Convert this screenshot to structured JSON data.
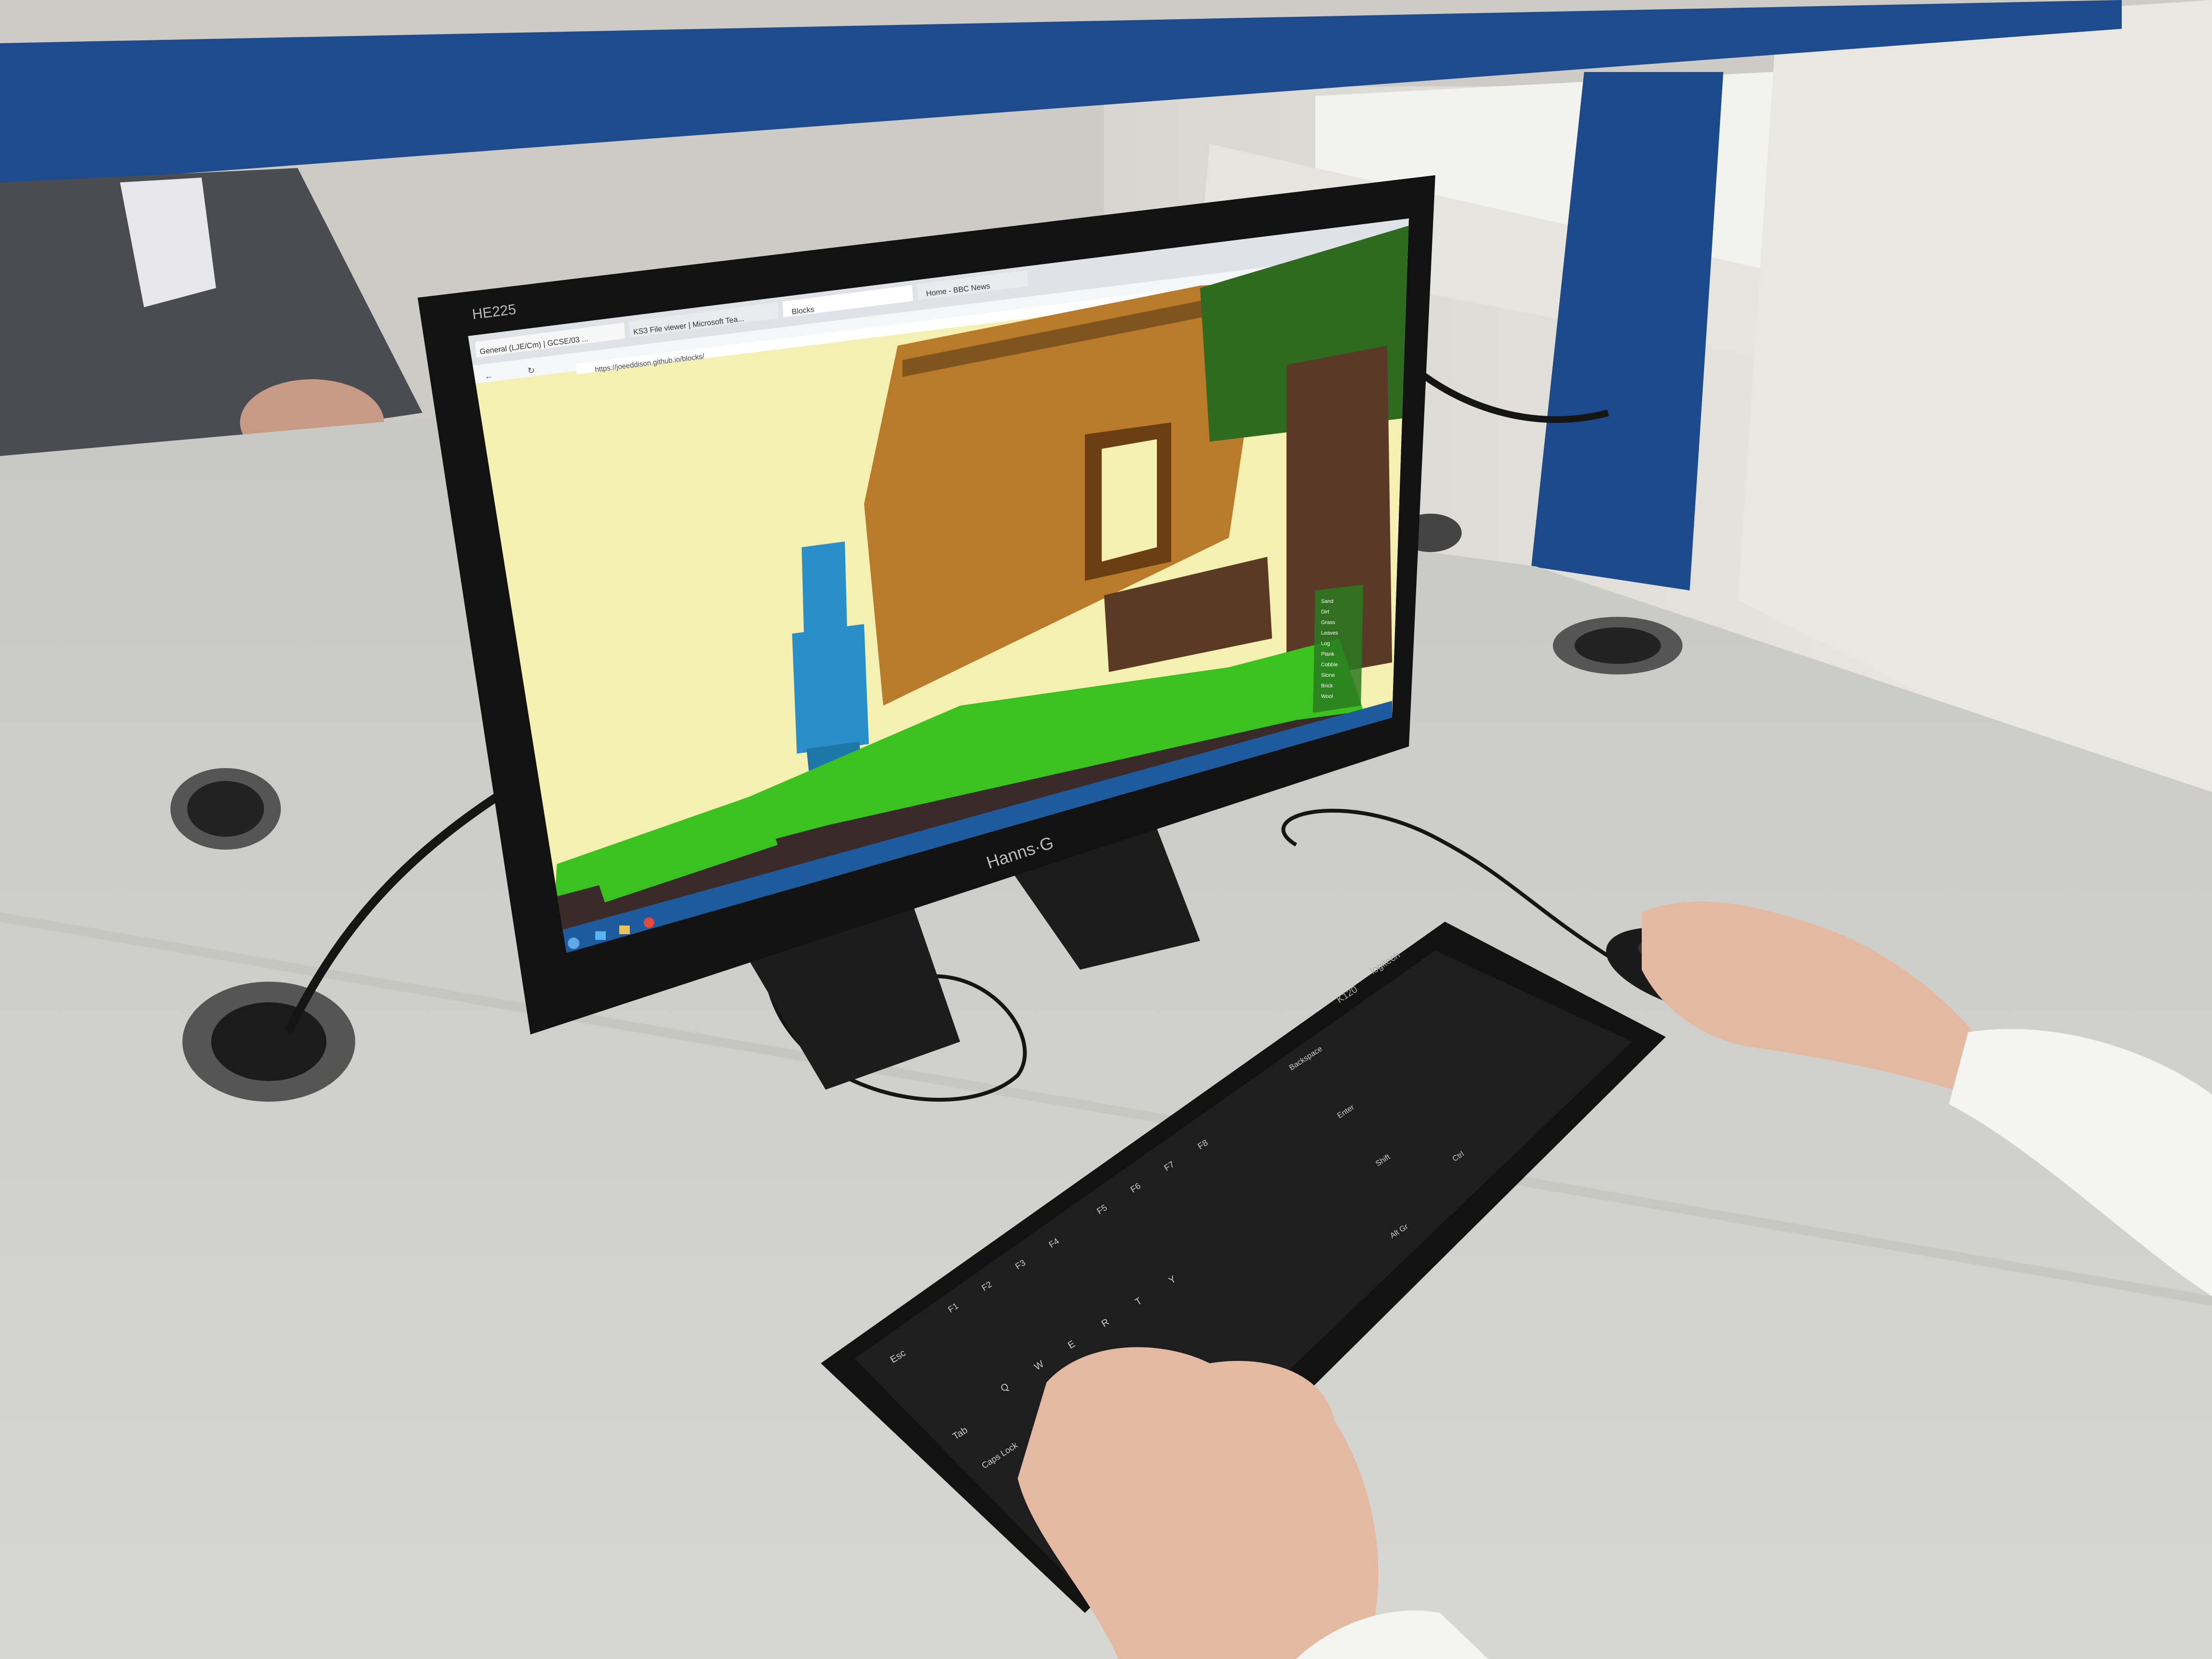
{
  "monitor": {
    "model_label": "HE225",
    "brand_label": "Hanns·G"
  },
  "browser": {
    "tabs": [
      {
        "label": "General (LJE/Cm) | GCSE/03 ...",
        "icon": "teams-icon"
      },
      {
        "label": "KS3 File viewer | Microsoft Tea...",
        "icon": "file-icon"
      },
      {
        "label": "Blocks",
        "icon": "game-icon"
      },
      {
        "label": "Home - BBC News",
        "icon": "news-icon"
      }
    ],
    "url": "https://joeeddison.github.io/blocks/"
  },
  "game": {
    "colors": {
      "sky": "#f3f0b0",
      "wood": "#b97a2a",
      "grass": "#3cc21e",
      "dirt": "#3b2a2a",
      "leaves": "#2f6b1e",
      "player": "#2a8fc8"
    },
    "inventory_items": [
      "Sand",
      "Dirt",
      "Grass",
      "Leaves",
      "Log",
      "Plank",
      "Cobble",
      "Stone",
      "Brick",
      "Wool"
    ]
  },
  "taskbar": {
    "icons": [
      "start-icon",
      "ie-icon",
      "folder-icon",
      "chrome-icon"
    ]
  },
  "keyboard": {
    "model_label": "K120",
    "brand_label": "logitech",
    "key_labels": [
      "Esc",
      "F1",
      "F2",
      "F3",
      "F4",
      "F5",
      "F6",
      "F7",
      "F8",
      "Tab",
      "Caps Lock",
      "Q",
      "W",
      "E",
      "R",
      "T",
      "Y",
      "Backspace",
      "Enter",
      "Shift",
      "Ctrl",
      "Alt Gr"
    ]
  }
}
